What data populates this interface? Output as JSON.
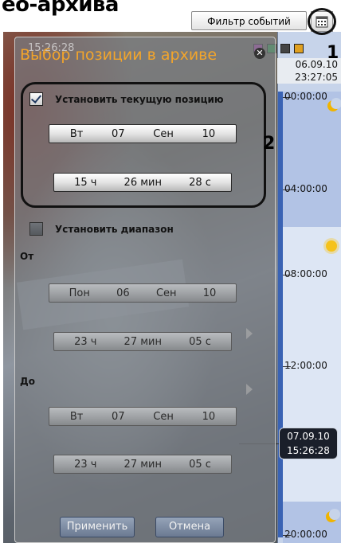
{
  "heading_fragment": "ео-архива",
  "filter_button": "Фильтр событий",
  "callouts": {
    "one": "1",
    "two": "2"
  },
  "timeline": {
    "date": "06.09.10",
    "time": "23:27:05",
    "ticks": [
      "00:00:00",
      "04:00:00",
      "08:00:00",
      "12:00:00",
      "20:00:00"
    ],
    "marker_date": "07.09.10",
    "marker_time": "15:26:28"
  },
  "video_overlay_time": "15:26:28",
  "dialog": {
    "title": "Выбор позиции в архиве",
    "current_position": {
      "checkbox_label": "Установить текущую позицию",
      "checked": true,
      "date": {
        "day": "Вт",
        "num": "07",
        "month": "Сен",
        "year": "10"
      },
      "time": {
        "hours": "15 ч",
        "minutes": "26 мин",
        "seconds": "28 с"
      }
    },
    "range": {
      "checkbox_label": "Установить диапазон",
      "checked": false,
      "from_label": "От",
      "from_date": {
        "day": "Пон",
        "num": "06",
        "month": "Сен",
        "year": "10"
      },
      "from_time": {
        "hours": "23 ч",
        "minutes": "27 мин",
        "seconds": "05 с"
      },
      "to_label": "До",
      "to_date": {
        "day": "Вт",
        "num": "07",
        "month": "Сен",
        "year": "10"
      },
      "to_time": {
        "hours": "23 ч",
        "minutes": "27 мин",
        "seconds": "05 с"
      }
    },
    "apply_button": "Применить",
    "cancel_button": "Отмена"
  },
  "colors": {
    "title": "#f3a52b",
    "timeline_bar": "#3a63b4",
    "timeline_bg": "#c7d4ea"
  }
}
